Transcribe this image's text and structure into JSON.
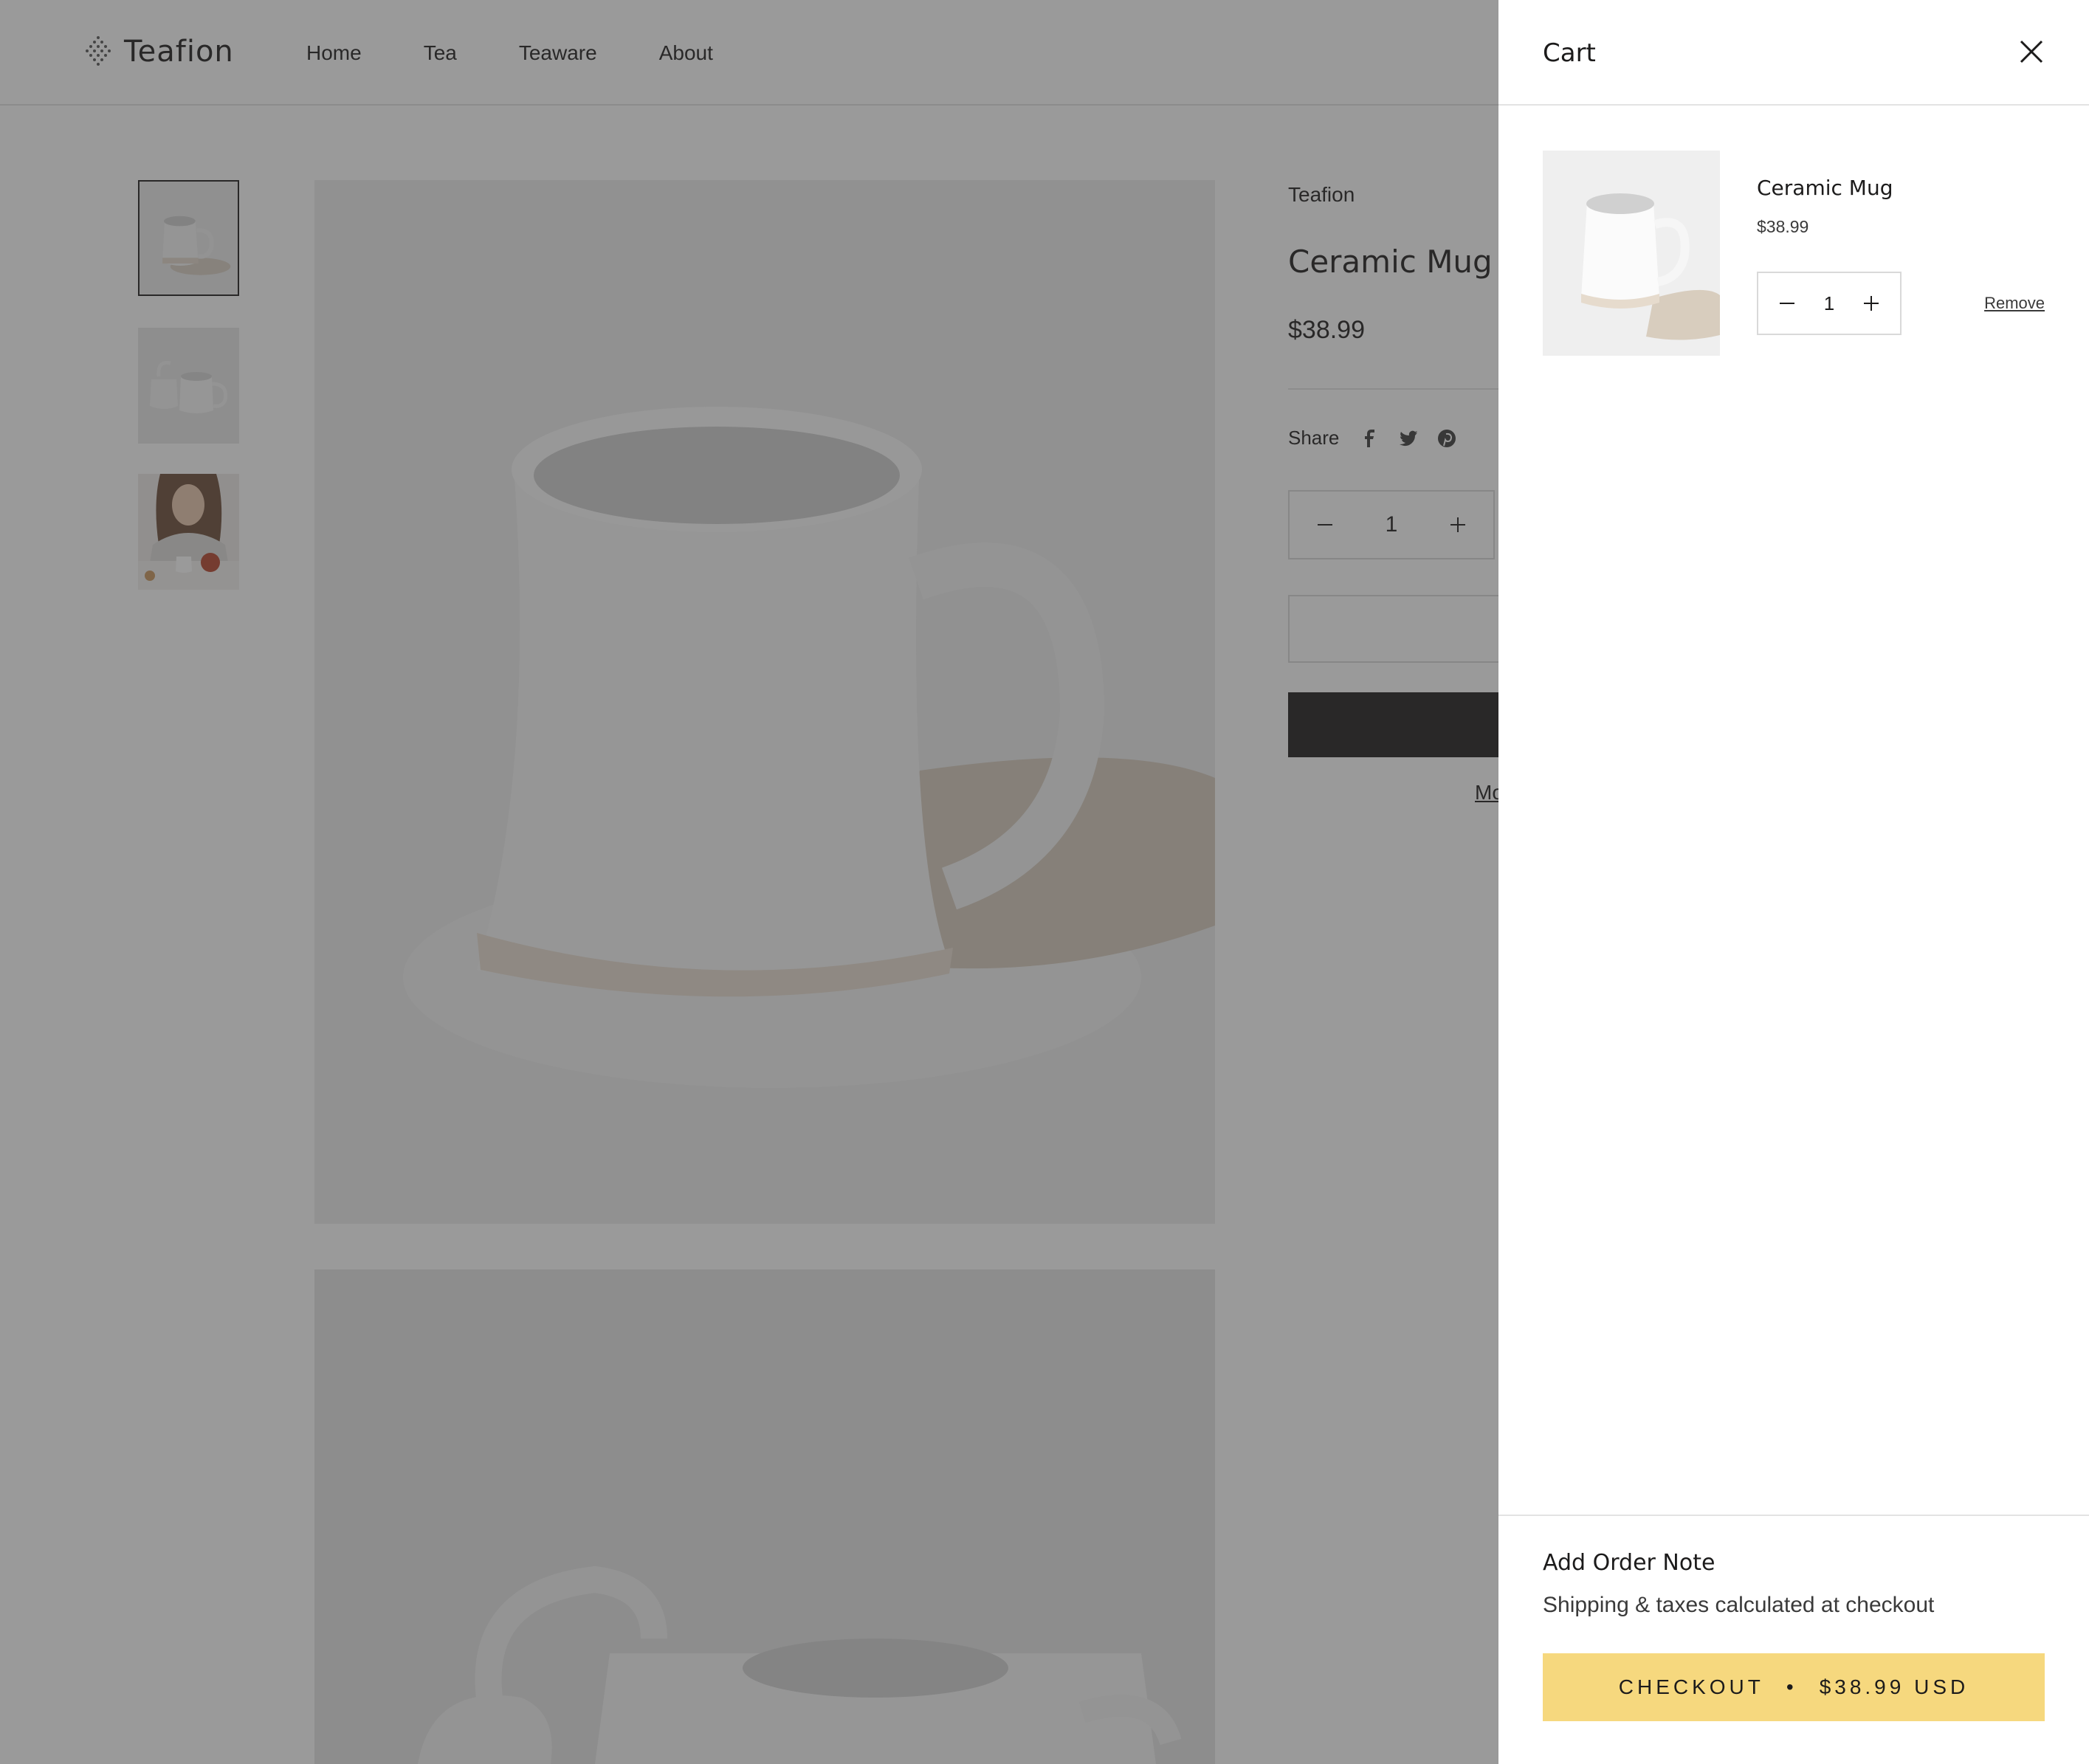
{
  "store": {
    "logo_text": "Teafion",
    "nav": [
      "Home",
      "Tea",
      "Teaware",
      "About"
    ]
  },
  "product": {
    "vendor": "Teafion",
    "title": "Ceramic Mug",
    "price": "$38.99",
    "share_label": "Share",
    "quantity": "1",
    "more_link": "Mo"
  },
  "cart": {
    "title": "Cart",
    "item": {
      "title": "Ceramic Mug",
      "price": "$38.99",
      "quantity": "1",
      "remove_label": "Remove"
    },
    "order_note_label": "Add Order Note",
    "shipping_note": "Shipping & taxes calculated at checkout",
    "checkout_label": "CHECKOUT",
    "checkout_separator": "•",
    "checkout_total": "$38.99 USD"
  },
  "colors": {
    "checkout_bg": "#f6d87e",
    "overlay": "rgba(54,54,54,0.5)",
    "text": "#1c1b1b"
  },
  "icons": [
    "logo-icon",
    "facebook-icon",
    "twitter-icon",
    "pinterest-icon",
    "minus-icon",
    "plus-icon",
    "close-icon"
  ]
}
